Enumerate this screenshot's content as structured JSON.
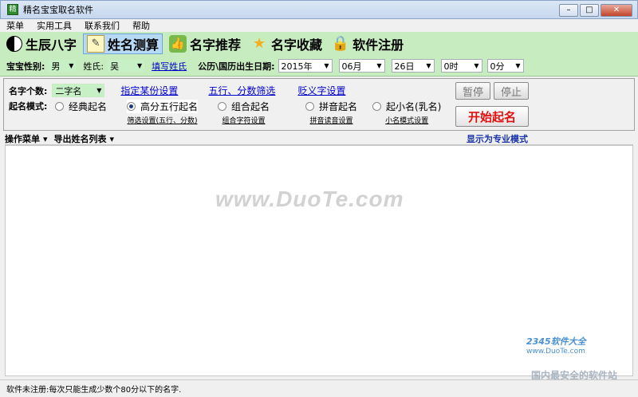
{
  "window": {
    "title": "精名宝宝取名软件",
    "icon_label": "精"
  },
  "menu": [
    "菜单",
    "实用工具",
    "联系我们",
    "帮助"
  ],
  "toolbar": [
    {
      "label": "生辰八字",
      "icon": "yinyang-icon"
    },
    {
      "label": "姓名测算",
      "icon": "notepad-icon"
    },
    {
      "label": "名字推荐",
      "icon": "thumbs-up-icon"
    },
    {
      "label": "名字收藏",
      "icon": "star-icon"
    },
    {
      "label": "软件注册",
      "icon": "lock-icon"
    }
  ],
  "settings": {
    "gender_label": "宝宝性别:",
    "gender_value": "男",
    "surname_label": "姓氏:",
    "surname_value": "吴",
    "fill_surname": "填写姓氏",
    "date_label": "公历\\国历出生日期:",
    "year": "2015年",
    "month": "06月",
    "day": "26日",
    "hour": "0时",
    "minute": "0分"
  },
  "options": {
    "count_label": "名字个数:",
    "count_value": "二字名",
    "link_fixed_char": "指定某份设置",
    "link_wuxing": "五行、分数筛选",
    "link_ambiguous": "贬义字设置",
    "mode_label": "起名模式:",
    "modes": [
      {
        "label": "经典起名",
        "selected": false,
        "sub": ""
      },
      {
        "label": "高分五行起名",
        "selected": true,
        "sub": "筛选设置(五行、分数)"
      },
      {
        "label": "组合起名",
        "selected": false,
        "sub": "组合字符设置"
      },
      {
        "label": "拼音起名",
        "selected": false,
        "sub": "拼音读音设置"
      },
      {
        "label": "起小名(乳名)",
        "selected": false,
        "sub": "小名模式设置"
      }
    ],
    "pause_label": "暂停",
    "stop_label": "停止",
    "start_label": "开始起名"
  },
  "results": {
    "ops_menu": "操作菜单",
    "export_list": "导出姓名列表",
    "pro_mode": "显示为专业模式"
  },
  "watermark": "www.DuoTe.com",
  "brand": {
    "name": "2345软件大全",
    "url": "www.DuoTe.com",
    "slogan": "国内最安全的软件站"
  },
  "status": "软件未注册:每次只能生成少数个80分以下的名字."
}
